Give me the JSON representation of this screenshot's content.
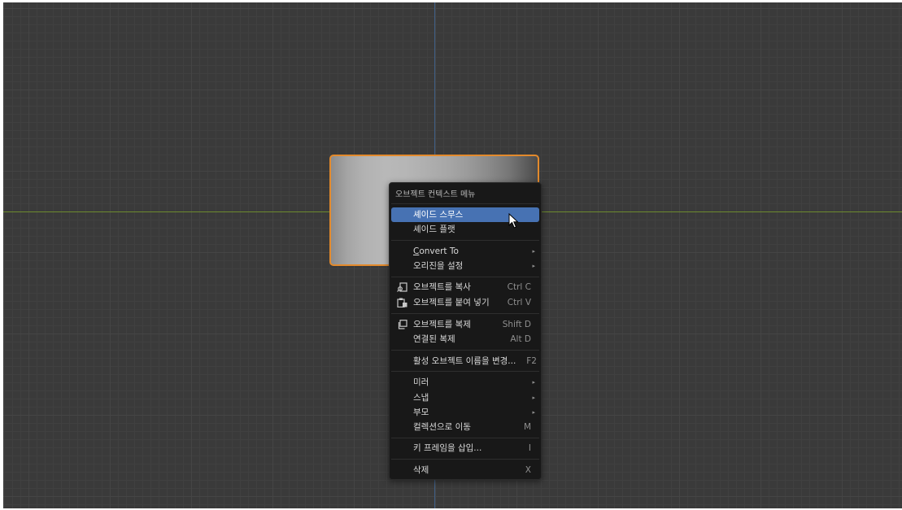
{
  "menu": {
    "title": "오브젝트 컨텍스트 메뉴",
    "items": {
      "shade_smooth": "셰이드 스무스",
      "shade_flat": "셰이드 플랫",
      "convert_to": "Convert To",
      "set_origin": "오리진을 설정",
      "copy_objects": {
        "label": "오브젝트를 복사",
        "shortcut": "Ctrl C"
      },
      "paste_objects": {
        "label": "오브젝트를 붙여 넣기",
        "shortcut": "Ctrl V"
      },
      "duplicate_objects": {
        "label": "오브젝트를 복제",
        "shortcut": "Shift D"
      },
      "duplicate_linked": {
        "label": "연결된 복제",
        "shortcut": "Alt D"
      },
      "rename_active": {
        "label": "활성 오브젝트 이름을 변경...",
        "shortcut": "F2"
      },
      "mirror": "미러",
      "snap": "스냅",
      "parent": "부모",
      "move_to_collection": {
        "label": "컬렉션으로 이동",
        "shortcut": "M"
      },
      "insert_keyframe": {
        "label": "키 프레임을 삽입...",
        "shortcut": "I"
      },
      "delete": {
        "label": "삭제",
        "shortcut": "X"
      }
    },
    "submenu_arrow": "▸",
    "icons": {
      "copy": "copy-icon",
      "paste": "paste-icon",
      "duplicate": "duplicate-icon"
    },
    "highlight_color": "#4772b3"
  },
  "viewport": {
    "selection_outline_color": "#e38a2c",
    "x_axis_color": "#6d8a2e",
    "y_axis_color": "#3f5f86"
  }
}
